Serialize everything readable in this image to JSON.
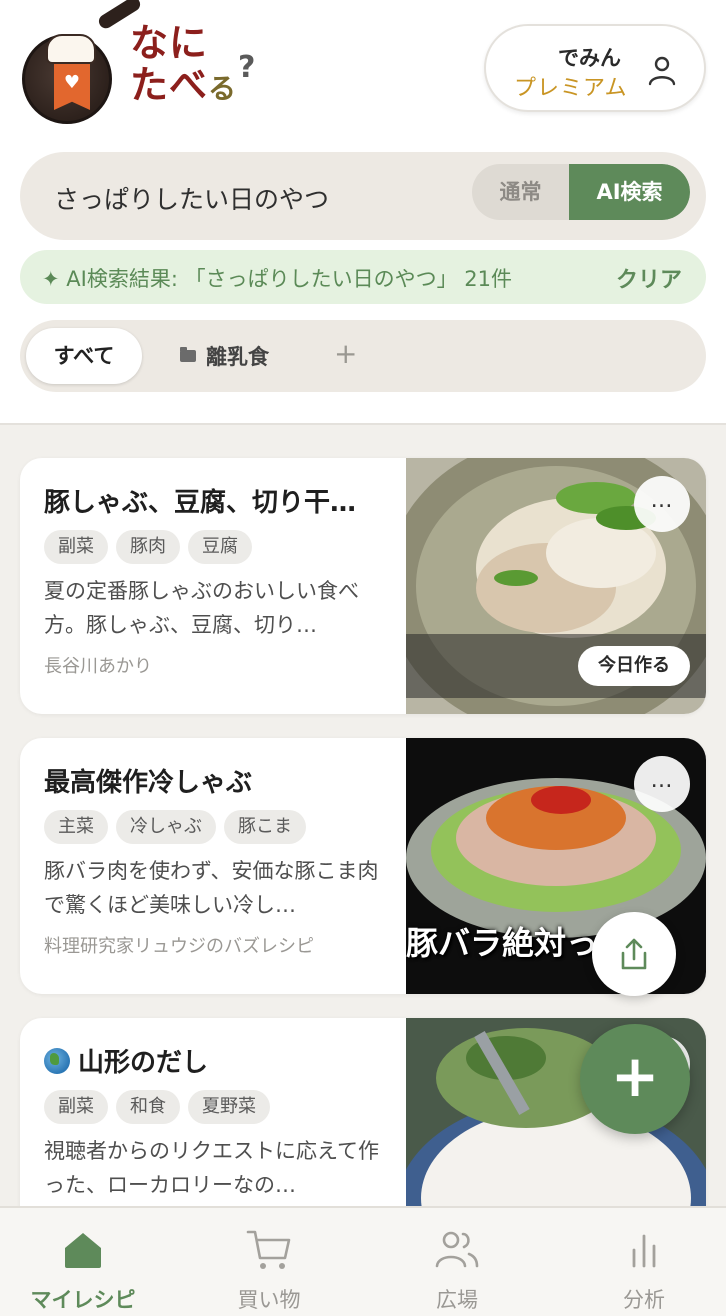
{
  "header": {
    "logo_text_line1": "なに",
    "logo_text_line2": "たべ",
    "logo_text_small": "る",
    "logo_qmark": "?",
    "profile_name": "でみん",
    "profile_tier": "プレミアム"
  },
  "search": {
    "query": "さっぱりしたい日のやつ",
    "mode_normal": "通常",
    "mode_ai": "AI検索",
    "active_mode": "AI検索"
  },
  "ai_banner": {
    "text": "✦ AI検索結果: 「さっぱりしたい日のやつ」 21件",
    "clear": "クリア"
  },
  "folders": {
    "all": "すべて",
    "items": [
      {
        "label": "離乳食"
      }
    ],
    "add": "+"
  },
  "recipes": [
    {
      "title": "豚しゃぶ、豆腐、切り干…",
      "tags": [
        "副菜",
        "豚肉",
        "豆腐"
      ],
      "description": "夏の定番豚しゃぶのおいしい食べ方。豚しゃぶ、豆腐、切り…",
      "author": "長谷川あかり",
      "today_button": "今日作る",
      "more": "…"
    },
    {
      "title": "最高傑作冷しゃぶ",
      "tags": [
        "主菜",
        "冷しゃぶ",
        "豚こま"
      ],
      "description": "豚バラ肉を使わず、安価な豚こま肉で驚くほど美味しい冷し…",
      "author": "料理研究家リュウジのバズレシピ",
      "overlay_text": "豚バラ絶対っ…な。",
      "more": "…"
    },
    {
      "title": "山形のだし",
      "tags": [
        "副菜",
        "和食",
        "夏野菜"
      ],
      "description": "視聴者からのリクエストに応えて作った、ローカロリーなの…",
      "author": "",
      "more": "…"
    }
  ],
  "fab": {
    "add": "+"
  },
  "bottom_nav": {
    "items": [
      {
        "label": "マイレシピ",
        "icon": "home-icon"
      },
      {
        "label": "買い物",
        "icon": "cart-icon"
      },
      {
        "label": "広場",
        "icon": "people-icon"
      },
      {
        "label": "分析",
        "icon": "bar-chart-icon"
      }
    ],
    "active": "マイレシピ"
  },
  "colors": {
    "accent_green": "#5e8a5a",
    "premium_gold": "#c99524",
    "logo_red": "#8c1f1c",
    "ai_banner_bg": "#e5f2e0"
  }
}
